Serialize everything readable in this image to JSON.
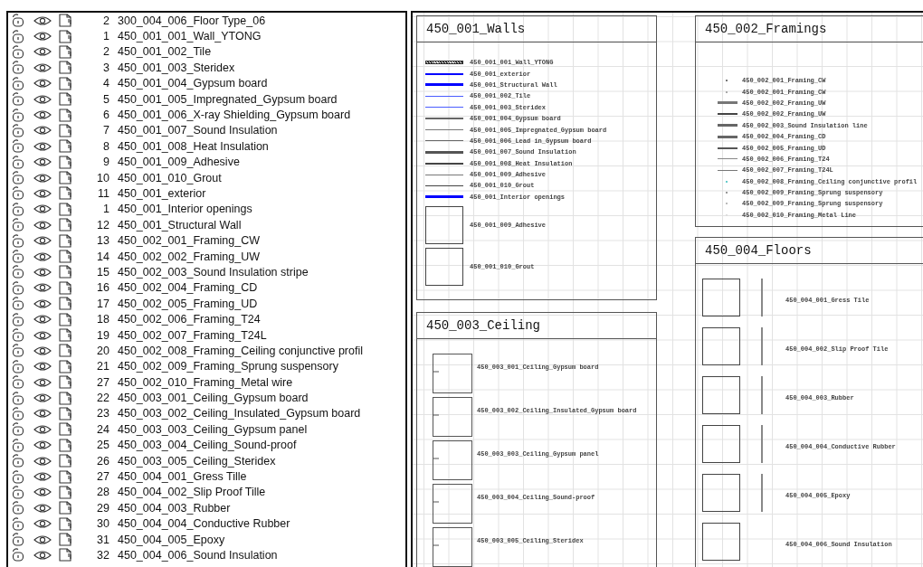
{
  "layers": [
    {
      "number": "2",
      "name": "300_004_006_Floor Type_06"
    },
    {
      "number": "1",
      "name": "450_001_001_Wall_YTONG"
    },
    {
      "number": "2",
      "name": "450_001_002_Tile"
    },
    {
      "number": "3",
      "name": "450_001_003_Steridex"
    },
    {
      "number": "4",
      "name": "450_001_004_Gypsum board"
    },
    {
      "number": "5",
      "name": "450_001_005_Impregnated_Gypsum board"
    },
    {
      "number": "6",
      "name": "450_001_006_X-ray Shielding_Gypsum board"
    },
    {
      "number": "7",
      "name": "450_001_007_Sound Insulation"
    },
    {
      "number": "8",
      "name": "450_001_008_Heat Insulation"
    },
    {
      "number": "9",
      "name": "450_001_009_Adhesive"
    },
    {
      "number": "10",
      "name": "450_001_010_Grout"
    },
    {
      "number": "11",
      "name": "450_001_exterior"
    },
    {
      "number": "1",
      "name": "450_001_Interior openings"
    },
    {
      "number": "12",
      "name": "450_001_Structural Wall"
    },
    {
      "number": "13",
      "name": "450_002_001_Framing_CW"
    },
    {
      "number": "14",
      "name": "450_002_002_Framing_UW"
    },
    {
      "number": "15",
      "name": "450_002_003_Sound Insulation stripe"
    },
    {
      "number": "16",
      "name": "450_002_004_Framing_CD"
    },
    {
      "number": "17",
      "name": "450_002_005_Framing_UD"
    },
    {
      "number": "18",
      "name": "450_002_006_Framing_T24"
    },
    {
      "number": "19",
      "name": "450_002_007_Framing_T24L"
    },
    {
      "number": "20",
      "name": "450_002_008_Framing_Ceiling conjunctive profil"
    },
    {
      "number": "21",
      "name": "450_002_009_Framing_Sprung suspensory"
    },
    {
      "number": "27",
      "name": "450_002_010_Framing_Metal wire"
    },
    {
      "number": "22",
      "name": "450_003_001_Ceiling_Gypsum board"
    },
    {
      "number": "23",
      "name": "450_003_002_Ceiling_Insulated_Gypsum board"
    },
    {
      "number": "24",
      "name": "450_003_003_Ceiling_Gypsum panel"
    },
    {
      "number": "25",
      "name": "450_003_004_Ceiling_Sound-proof"
    },
    {
      "number": "26",
      "name": "450_003_005_Ceiling_Steridex"
    },
    {
      "number": "27",
      "name": "450_004_001_Gress Tille"
    },
    {
      "number": "28",
      "name": "450_004_002_Slip Proof Tille"
    },
    {
      "number": "29",
      "name": "450_004_003_Rubber"
    },
    {
      "number": "30",
      "name": "450_004_004_Conductive Rubber"
    },
    {
      "number": "31",
      "name": "450_004_005_Epoxy"
    },
    {
      "number": "32",
      "name": "450_004_006_Sound Insulation"
    }
  ],
  "canvas": {
    "panels": [
      {
        "title": "450_001_Walls",
        "items": [
          {
            "kind": "hatched",
            "label": "450_001_001_Wall_YTONG"
          },
          {
            "kind": "medium-line",
            "color": "#0000ff",
            "label": "450_001_exterior"
          },
          {
            "kind": "thick-line",
            "color": "#0000ff",
            "label": "450_001_Structural Wall"
          },
          {
            "kind": "thin-line",
            "color": "#4a5cff",
            "label": "450_001_002_Tile"
          },
          {
            "kind": "thin-line",
            "color": "#4a5cff",
            "label": "450_001_003_Steridex"
          },
          {
            "kind": "medium-line",
            "color": "#666666",
            "label": "450_001_004_Gypsum board"
          },
          {
            "kind": "thin-line",
            "color": "#777777",
            "label": "450_001_005_Impregnated_Gypsum board"
          },
          {
            "kind": "thin-line",
            "color": "#666666",
            "label": "450_001_006_Lead in_Gypsum board"
          },
          {
            "kind": "thick-line",
            "color": "#555555",
            "label": "450_001_007_Sound Insulation"
          },
          {
            "kind": "medium-line",
            "color": "#444444",
            "label": "450_001_008_Heat Insulation"
          },
          {
            "kind": "thin-line",
            "color": "#777777",
            "label": "450_001_009_Adhesive"
          },
          {
            "kind": "thin-line",
            "color": "#444444",
            "label": "450_001_010_Grout"
          },
          {
            "kind": "thick-line",
            "color": "#0000ff",
            "label": "450_001_Interior openings"
          },
          {
            "kind": "box",
            "label": "450_001_009_Adhesive"
          },
          {
            "kind": "box",
            "label": "450_001_010_Grout"
          }
        ]
      },
      {
        "title": "450_003_Ceiling",
        "items": [
          {
            "kind": "box-tick",
            "label": "450_003_001_Ceiling_Gypsum board"
          },
          {
            "kind": "box-tick",
            "label": "450_003_002_Ceiling_Insulated_Gypsum board"
          },
          {
            "kind": "box-tick",
            "label": "450_003_003_Ceiling_Gypsum panel"
          },
          {
            "kind": "box-tick",
            "label": "450_003_004_Ceiling_Sound-proof"
          },
          {
            "kind": "box-tick",
            "label": "450_003_005_Ceiling_Steridex"
          }
        ]
      },
      {
        "title": "450_002_Framings",
        "items": [
          {
            "kind": "dot",
            "color": "#777777",
            "label": "450_002_001_Framing_CW"
          },
          {
            "kind": "dot",
            "color": "#aaaaaa",
            "label": "450_002_001_Framing_CW"
          },
          {
            "kind": "thick-line",
            "color": "#777777",
            "label": "450_002_002_Framing_UW"
          },
          {
            "kind": "medium-line",
            "color": "#444444",
            "label": "450_002_002_Framing_UW"
          },
          {
            "kind": "thick-line",
            "color": "#666666",
            "label": "450_002_003_Sound Insulation line"
          },
          {
            "kind": "thick-line",
            "color": "#666666",
            "label": "450_002_004_Framing_CD"
          },
          {
            "kind": "medium-line",
            "color": "#555555",
            "label": "450_002_005_Framing_UD"
          },
          {
            "kind": "thin-line",
            "color": "#888888",
            "label": "450_002_006_Framing_T24"
          },
          {
            "kind": "thin-line",
            "color": "#777777",
            "label": "450_002_007_Framing_T24L"
          },
          {
            "kind": "dot",
            "color": "#66cccc",
            "label": "450_002_008_Framing_Ceiling conjunctive profil"
          },
          {
            "kind": "dot",
            "color": "#999999",
            "label": "450_002_009_Framing_Sprung suspensory"
          },
          {
            "kind": "dot",
            "color": "#bbbbbb",
            "label": "450_002_009_Framing_Sprung suspensory"
          },
          {
            "kind": "dot",
            "color": "#dddddd",
            "label": "450_002_010_Framing_Metal Line"
          }
        ]
      },
      {
        "title": "450_004_Floors",
        "items": [
          {
            "kind": "box-bar",
            "label": "450_004_001_Gress Tile"
          },
          {
            "kind": "box-bar",
            "label": "450_004_002_Slip Proof Tile"
          },
          {
            "kind": "box-bar",
            "label": "450_004_003_Rubber"
          },
          {
            "kind": "box-bar",
            "label": "450_004_004_Conductive Rubber"
          },
          {
            "kind": "box-bar",
            "label": "450_004_005_Epoxy"
          },
          {
            "kind": "box",
            "label": "450_004_006_Sound Insulation"
          }
        ]
      }
    ]
  }
}
